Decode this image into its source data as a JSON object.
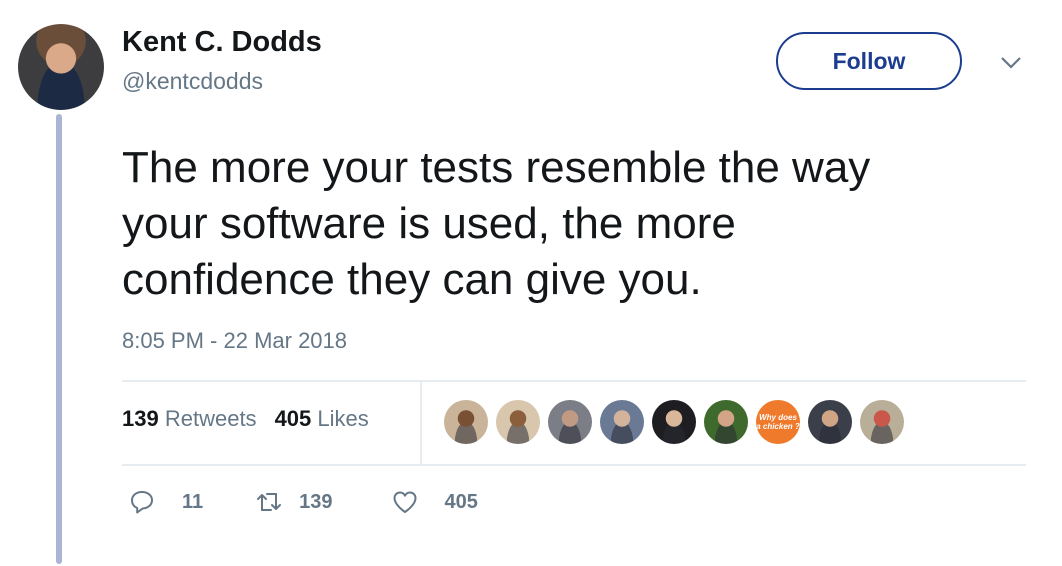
{
  "author": {
    "name": "Kent C. Dodds",
    "handle": "@kentcdodds"
  },
  "header": {
    "follow_label": "Follow",
    "menu_icon": "chevron-down-icon"
  },
  "tweet": {
    "lines": [
      "The more your tests resemble the way",
      "your software is used, the more",
      "confidence they can give you."
    ],
    "timestamp": "8:05 PM - 22 Mar 2018"
  },
  "stats": {
    "retweets_count": "139",
    "retweets_label": "Retweets",
    "likes_count": "405",
    "likes_label": "Likes"
  },
  "likers": [
    {
      "kind": "photo",
      "bg": "#c9b49a",
      "face": "#7a5034"
    },
    {
      "kind": "photo",
      "bg": "#d8c6ad",
      "face": "#8b5e3c"
    },
    {
      "kind": "photo",
      "bg": "#7b7e86",
      "face": "#c09a82"
    },
    {
      "kind": "photo",
      "bg": "#6a7a95",
      "face": "#d3b39c"
    },
    {
      "kind": "photo",
      "bg": "#1e1e22",
      "face": "#d9b79a"
    },
    {
      "kind": "photo",
      "bg": "#3e6a2e",
      "face": "#d3a487"
    },
    {
      "kind": "text",
      "bg": "#ef7a2c",
      "text": "Why does a chicken ?"
    },
    {
      "kind": "photo",
      "bg": "#3a3f4a",
      "face": "#d0a586"
    },
    {
      "kind": "photo",
      "bg": "#b9ae98",
      "face": "#c9574a"
    }
  ],
  "actions": {
    "replies": "11",
    "retweets": "139",
    "likes": "405"
  },
  "colors": {
    "accent": "#1c3d8f",
    "muted": "#657786",
    "thread_line": "#aab4d4",
    "divider": "#e6ecf0"
  }
}
